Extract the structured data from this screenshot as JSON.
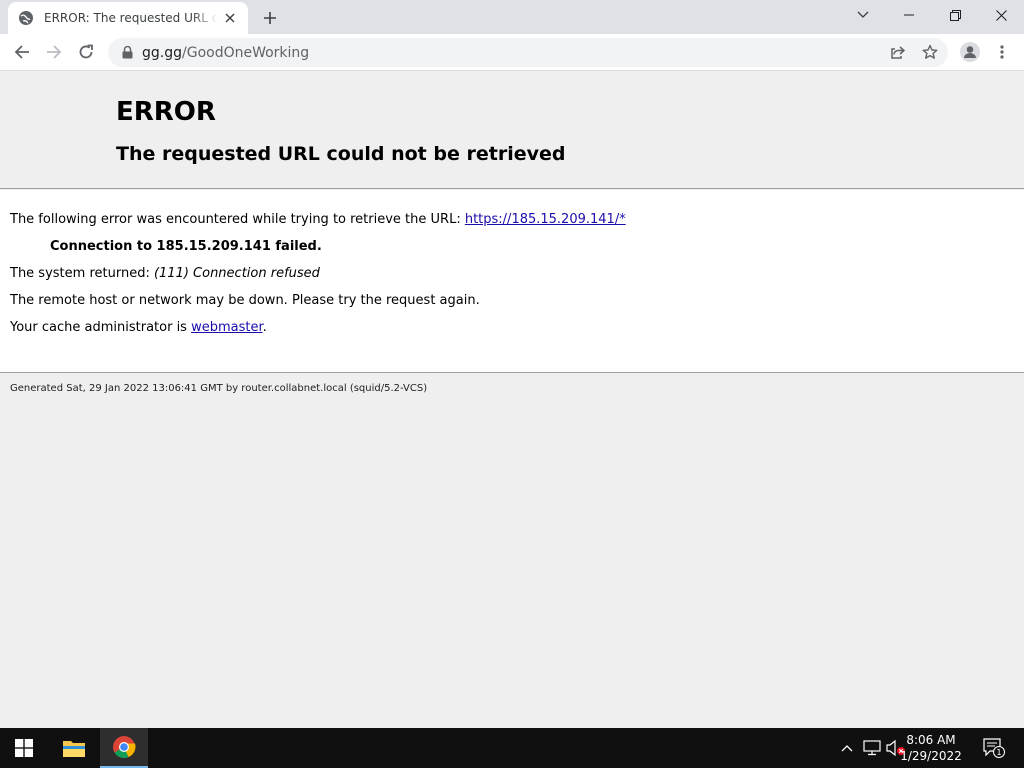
{
  "browser": {
    "tab": {
      "title": "ERROR: The requested URL could not be retrieved"
    },
    "address": {
      "host": "gg.gg",
      "path": "/GoodOneWorking"
    }
  },
  "page": {
    "title": "ERROR",
    "subtitle": "The requested URL could not be retrieved",
    "intro": "The following error was encountered while trying to retrieve the URL: ",
    "url_link": "https://185.15.209.141/*",
    "failed": "Connection to 185.15.209.141 failed.",
    "system_prefix": "The system returned: ",
    "system_value": "(111) Connection refused",
    "remote": "The remote host or network may be down. Please try the request again.",
    "cache_prefix": "Your cache administrator is ",
    "cache_link": "webmaster",
    "cache_suffix": ".",
    "generated": "Generated Sat, 29 Jan 2022 13:06:41 GMT by router.collabnet.local (squid/5.2-VCS)"
  },
  "taskbar": {
    "time": "8:06 AM",
    "date": "1/29/2022",
    "notification_count": "1"
  },
  "colors": {
    "link": "#1a0dab",
    "taskbar": "#101010",
    "tabstrip": "#dee1e6"
  }
}
